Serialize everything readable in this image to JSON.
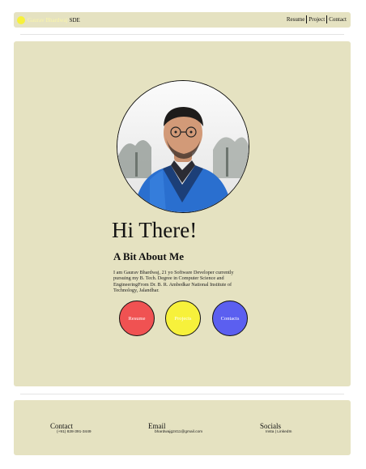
{
  "header": {
    "brand_name": "Gaurav Bhardwaj",
    "brand_role": "SDE",
    "nav": [
      "Resume",
      "Project",
      "Contact"
    ]
  },
  "hero": {
    "greeting": "Hi There!",
    "about_title": "A Bit About Me",
    "about_text": "I am Gaurav Bhardwaj, 21 yo Software Developer currently pursuing my B. Tech. Degree in Computer Science and EngineeringFrom Dr. B. R. Ambedkar National Institute of Technology, Jalandhar."
  },
  "buttons": {
    "resume": "Resume",
    "projects": "Projects",
    "contacts": "Contacts"
  },
  "footer": {
    "contact_label": "Contact",
    "contact_value": "(+91) 828-391-3449",
    "email_label": "Email",
    "email_value": "bhardwajg2411@gmail.com",
    "socials_label": "Socials",
    "socials_value": "Insta | LinkedIn"
  },
  "colors": {
    "panel": "#e5e2c1",
    "resume_button": "#f05252",
    "projects_button": "#f7f13b",
    "contacts_button": "#5b5ff0"
  }
}
